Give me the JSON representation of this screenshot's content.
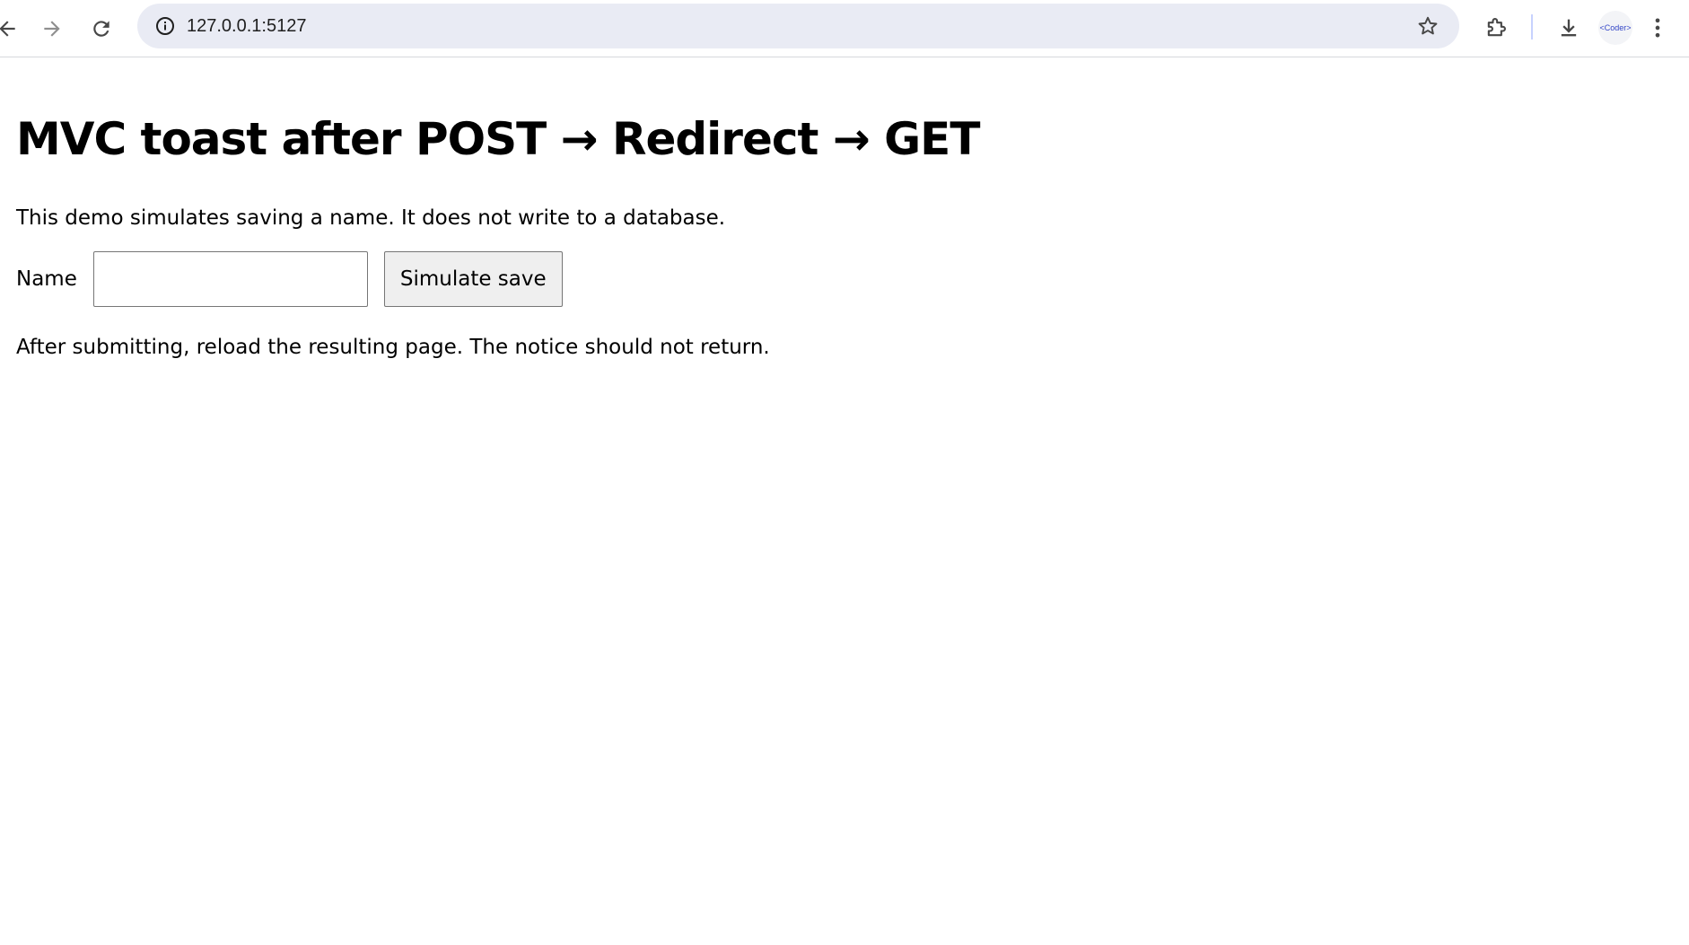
{
  "browser": {
    "url": "127.0.0.1:5127",
    "avatar_text": "<Coder>"
  },
  "page": {
    "title": "MVC toast after POST → Redirect → GET",
    "intro": "This demo simulates saving a name. It does not write to a database.",
    "form": {
      "name_label": "Name",
      "name_value": "",
      "save_label": "Simulate save"
    },
    "note": "After submitting, reload the resulting page. The notice should not return."
  },
  "icons": {
    "back": "arrow-left-icon",
    "forward": "arrow-right-icon",
    "reload": "reload-icon",
    "site_info": "info-icon",
    "bookmark": "star-icon",
    "extensions": "puzzle-icon",
    "downloads": "download-icon",
    "menu": "kebab-menu-icon"
  }
}
